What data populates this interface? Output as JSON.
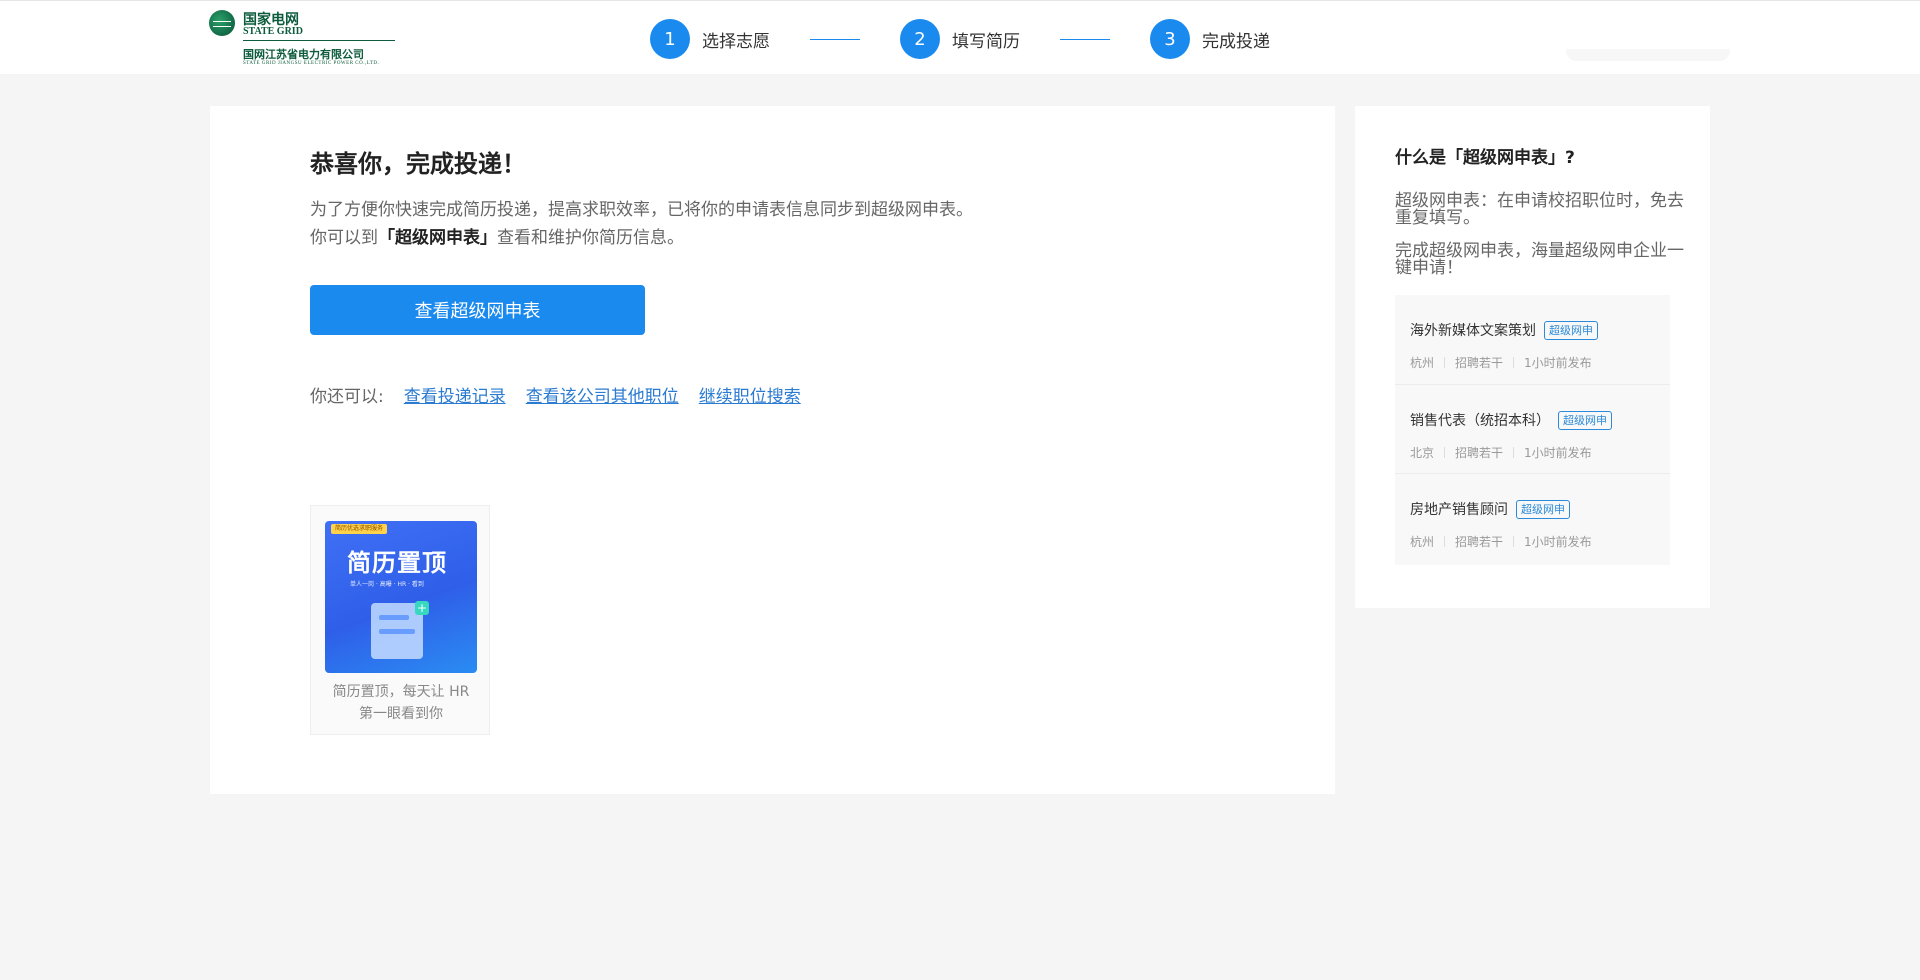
{
  "header": {
    "logo": {
      "cn": "国家电网",
      "en": "STATE GRID",
      "company": "国网江苏省电力有限公司",
      "company_en": "STATE GRID JIANGSU ELECTRIC POWER CO.,LTD."
    },
    "steps": [
      {
        "num": "1",
        "label": "选择志愿"
      },
      {
        "num": "2",
        "label": "填写简历"
      },
      {
        "num": "3",
        "label": "完成投递"
      }
    ]
  },
  "main": {
    "title": "恭喜你，完成投递！",
    "desc_line1": "为了方便你快速完成简历投递，提高求职效率，已将你的申请表信息同步到超级网申表。",
    "desc_line2_prefix": "你可以到",
    "desc_line2_bold": "「超级网申表」",
    "desc_line2_suffix": "查看和维护你简历信息。",
    "primary_button": "查看超级网申表",
    "also_label": "你还可以:",
    "links": [
      "查看投递记录",
      "查看该公司其他职位",
      "继续职位搜索"
    ],
    "promo": {
      "badge": "简历优选求职服务",
      "big_text": "简历置顶",
      "small_text": "单人一岗 · 高曝 · HR · 看到",
      "caption_line1": "简历置顶，每天让 HR",
      "caption_line2": "第一眼看到你"
    }
  },
  "sidebar": {
    "title": "什么是「超级网申表」?",
    "p1": "超级网申表：在申请校招职位时，免去重复填写。",
    "p2": "完成超级网申表，海量超级网申企业一键申请！",
    "jobs": [
      {
        "name": "海外新媒体文案策划",
        "tag": "超级网申",
        "city": "杭州",
        "count": "招聘若干",
        "time": "1小时前发布"
      },
      {
        "name": "销售代表（统招本科）",
        "tag": "超级网申",
        "city": "北京",
        "count": "招聘若干",
        "time": "1小时前发布"
      },
      {
        "name": "房地产销售顾问",
        "tag": "超级网申",
        "city": "杭州",
        "count": "招聘若干",
        "time": "1小时前发布"
      }
    ]
  },
  "colors": {
    "accent": "#1a8aee",
    "link": "#2b7bd1",
    "logo_green": "#0c5b3c"
  }
}
